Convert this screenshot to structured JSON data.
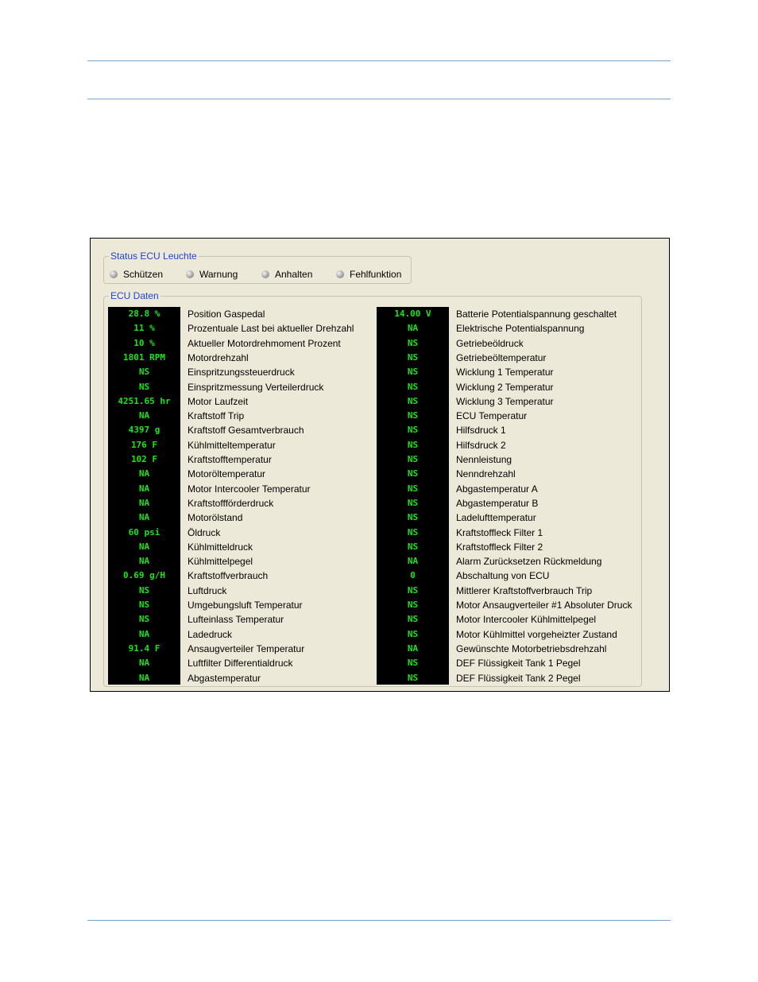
{
  "status_group": {
    "title": "Status ECU Leuchte",
    "leds": [
      "Schützen",
      "Warnung",
      "Anhalten",
      "Fehlfunktion"
    ]
  },
  "ecu_group": {
    "title": "ECU Daten",
    "left": [
      {
        "value": "28.8 %",
        "label": "Position Gaspedal"
      },
      {
        "value": "11 %",
        "label": "Prozentuale Last bei aktueller Drehzahl"
      },
      {
        "value": "10 %",
        "label": "Aktueller Motordrehmoment Prozent"
      },
      {
        "value": "1801 RPM",
        "label": "Motordrehzahl"
      },
      {
        "value": "NS",
        "label": "Einspritzungssteuerdruck"
      },
      {
        "value": "NS",
        "label": "Einspritzmessung Verteilerdruck"
      },
      {
        "value": "4251.65 hr",
        "label": "Motor Laufzeit"
      },
      {
        "value": "NA",
        "label": "Kraftstoff Trip"
      },
      {
        "value": "4397 g",
        "label": "Kraftstoff Gesamtverbrauch"
      },
      {
        "value": "176 F",
        "label": "Kühlmitteltemperatur"
      },
      {
        "value": "102 F",
        "label": "Kraftstofftemperatur"
      },
      {
        "value": "NA",
        "label": "Motoröltemperatur"
      },
      {
        "value": "NA",
        "label": "Motor Intercooler Temperatur"
      },
      {
        "value": "NA",
        "label": "Kraftstoffförderdruck"
      },
      {
        "value": "NA",
        "label": "Motorölstand"
      },
      {
        "value": "60 psi",
        "label": "Öldruck"
      },
      {
        "value": "NA",
        "label": "Kühlmitteldruck"
      },
      {
        "value": "NA",
        "label": "Kühlmittelpegel"
      },
      {
        "value": "0.69 g/H",
        "label": "Kraftstoffverbrauch"
      },
      {
        "value": "NS",
        "label": "Luftdruck"
      },
      {
        "value": "NS",
        "label": "Umgebungsluft Temperatur"
      },
      {
        "value": "NS",
        "label": "Lufteinlass Temperatur"
      },
      {
        "value": "NA",
        "label": "Ladedruck"
      },
      {
        "value": "91.4 F",
        "label": "Ansaugverteiler Temperatur"
      },
      {
        "value": "NA",
        "label": "Luftfilter Differentialdruck"
      },
      {
        "value": "NA",
        "label": "Abgastemperatur"
      }
    ],
    "right": [
      {
        "value": "14.00 V",
        "label": "Batterie Potentialspannung geschaltet"
      },
      {
        "value": "NA",
        "label": "Elektrische Potentialspannung"
      },
      {
        "value": "NS",
        "label": "Getriebeöldruck"
      },
      {
        "value": "NS",
        "label": "Getriebeöltemperatur"
      },
      {
        "value": "NS",
        "label": "Wicklung 1 Temperatur"
      },
      {
        "value": "NS",
        "label": "Wicklung 2 Temperatur"
      },
      {
        "value": "NS",
        "label": "Wicklung 3 Temperatur"
      },
      {
        "value": "NS",
        "label": "ECU Temperatur"
      },
      {
        "value": "NS",
        "label": "Hilfsdruck 1"
      },
      {
        "value": "NS",
        "label": "Hilfsdruck 2"
      },
      {
        "value": "NS",
        "label": "Nennleistung"
      },
      {
        "value": "NS",
        "label": "Nenndrehzahl"
      },
      {
        "value": "NS",
        "label": "Abgastemperatur A"
      },
      {
        "value": "NS",
        "label": "Abgastemperatur B"
      },
      {
        "value": "NS",
        "label": "Ladelufttemperatur"
      },
      {
        "value": "NS",
        "label": "Kraftstoffleck Filter 1"
      },
      {
        "value": "NS",
        "label": "Kraftstoffleck Filter 2"
      },
      {
        "value": "NA",
        "label": "Alarm Zurücksetzen Rückmeldung"
      },
      {
        "value": "0",
        "label": "Abschaltung von ECU"
      },
      {
        "value": "NS",
        "label": "Mittlerer Kraftstoffverbrauch Trip"
      },
      {
        "value": "NS",
        "label": "Motor Ansaugverteiler #1 Absoluter Druck"
      },
      {
        "value": "NS",
        "label": "Motor Intercooler Kühlmittelpegel"
      },
      {
        "value": "NS",
        "label": "Motor Kühlmittel vorgeheizter Zustand"
      },
      {
        "value": "NA",
        "label": "Gewünschte Motorbetriebsdrehzahl"
      },
      {
        "value": "NS",
        "label": "DEF Flüssigkeit Tank 1 Pegel"
      },
      {
        "value": "NS",
        "label": "DEF Flüssigkeit Tank 2 Pegel"
      }
    ]
  }
}
